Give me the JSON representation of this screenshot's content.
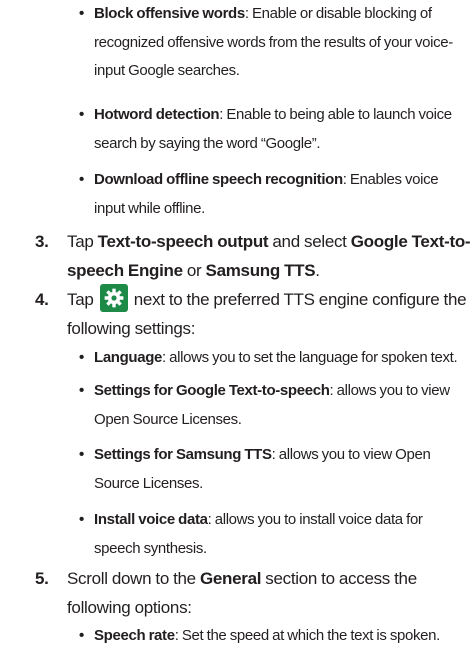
{
  "bullet_char": "•",
  "section_a": {
    "items": [
      {
        "term": "Block offensive words",
        "text": ": Enable or disable blocking of recognized offensive words from the results of your voice-input Google searches."
      },
      {
        "term": "Hotword detection",
        "text": ": Enable to being able to launch voice search by saying the word “Google”."
      },
      {
        "term": "Download offline speech recognition",
        "text": ": Enables voice input while offline."
      }
    ]
  },
  "step3": {
    "number": "3.",
    "pre": "Tap ",
    "term1": "Text-to-speech output",
    "mid1": " and select ",
    "term2": "Google Text-to-speech Engine",
    "mid2": " or ",
    "term3": "Samsung TTS",
    "end": "."
  },
  "step4": {
    "number": "4.",
    "pre": "Tap ",
    "icon": "gear-icon",
    "icon_color": "#1d8a48",
    "text": " next to the preferred TTS engine configure the following settings:",
    "items": [
      {
        "term": "Language",
        "text": ": allows you to set the language for spoken text."
      },
      {
        "term": "Settings for Google Text-to-speech",
        "text": ": allows you to view Open Source Licenses."
      },
      {
        "term": "Settings for Samsung TTS",
        "text": ": allows you to view Open Source Licenses."
      },
      {
        "term": "Install voice data",
        "text": ": allows you to install voice data for speech synthesis."
      }
    ]
  },
  "step5": {
    "number": "5.",
    "pre": "Scroll down to the ",
    "term": "General",
    "text": " section to access the following options:",
    "items": [
      {
        "term": "Speech rate",
        "text": ": Set the speed at which the text is spoken."
      }
    ]
  }
}
